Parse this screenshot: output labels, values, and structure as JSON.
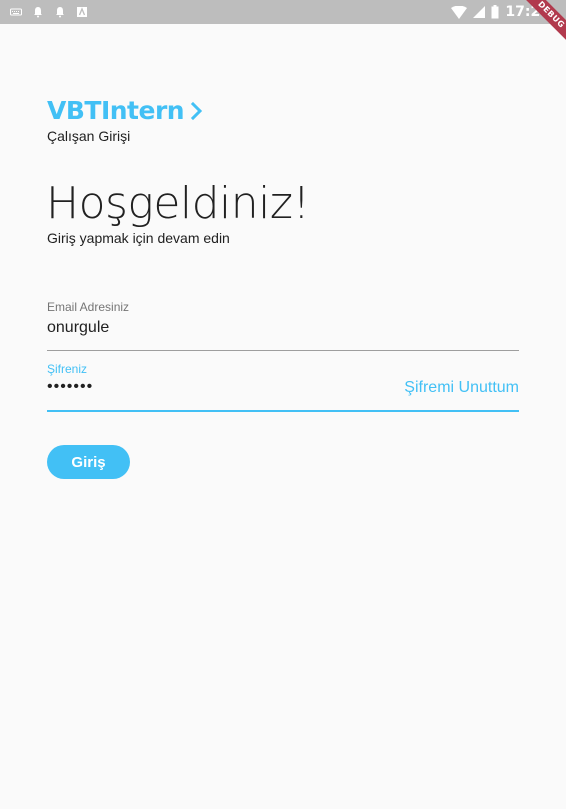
{
  "status_bar": {
    "time": "17:21",
    "left_icons": [
      "keyboard-icon",
      "notification-icon",
      "notification-icon",
      "app-icon"
    ],
    "right_icons": [
      "wifi-icon",
      "signal-icon",
      "battery-icon"
    ]
  },
  "debug_banner": "DEBUG",
  "brand": {
    "title": "VBTIntern",
    "subtitle": "Çalışan Girişi"
  },
  "welcome": {
    "title": "Hoşgeldiniz!",
    "subtitle": "Giriş yapmak için devam edin"
  },
  "form": {
    "email_label": "Email Adresiniz",
    "email_value": "onurgule",
    "password_label": "Şifreniz",
    "password_value": "•••••••",
    "forgot_label": "Şifremi Unuttum",
    "login_label": "Giriş"
  },
  "colors": {
    "accent": "#42c0f5",
    "status_bar": "#bdbdbd",
    "background": "#fafafa"
  }
}
